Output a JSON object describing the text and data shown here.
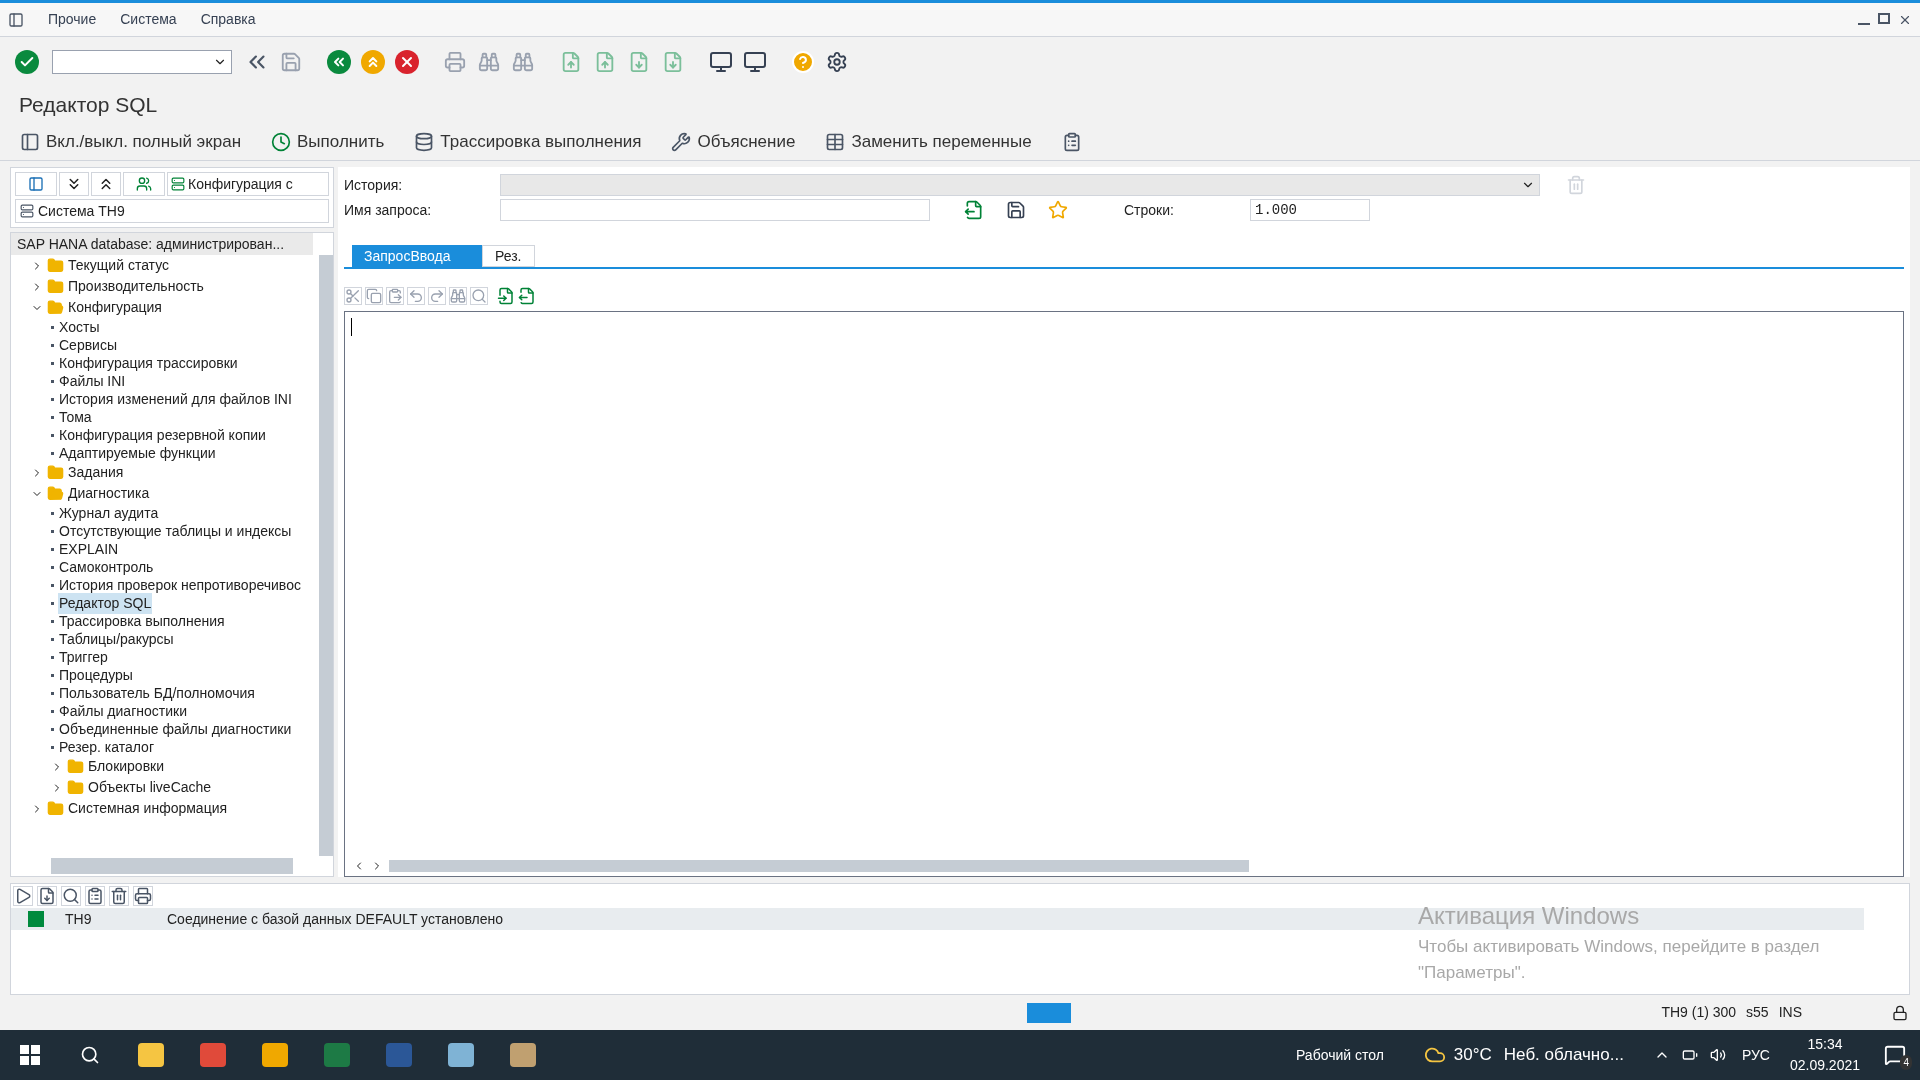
{
  "menu": [
    "Прочие",
    "Система",
    "Справка"
  ],
  "title": "Редактор SQL",
  "app_toolbar": [
    {
      "label": "Вкл./выкл. полный экран",
      "kind": "fullscreen"
    },
    {
      "label": "Выполнить",
      "kind": "execute"
    },
    {
      "label": "Трассировка выполнения",
      "kind": "trace"
    },
    {
      "label": "Объяснение",
      "kind": "explain"
    },
    {
      "label": "Заменить переменные",
      "kind": "replace"
    }
  ],
  "left": {
    "config_dropdown": "Конфигурация с",
    "system": "Система TH9",
    "tree": {
      "header": "SAP HANA database: администрирован...",
      "items": [
        {
          "label": "Текущий статус",
          "kind": "folder",
          "expanded": false
        },
        {
          "label": "Производительность",
          "kind": "folder",
          "expanded": false
        },
        {
          "label": "Конфигурация",
          "kind": "folder",
          "expanded": true,
          "children": [
            {
              "label": "Хосты",
              "kind": "leaf",
              "selected": false
            },
            {
              "label": "Сервисы",
              "kind": "leaf",
              "selected": false
            },
            {
              "label": "Конфигурация трассировки",
              "kind": "leaf",
              "selected": false
            },
            {
              "label": "Файлы INI",
              "kind": "leaf",
              "selected": false
            },
            {
              "label": "История изменений для файлов INI",
              "kind": "leaf",
              "selected": false
            },
            {
              "label": "Тома",
              "kind": "leaf",
              "selected": false
            },
            {
              "label": "Конфигурация резервной копии",
              "kind": "leaf",
              "selected": false
            },
            {
              "label": "Адаптируемые функции",
              "kind": "leaf",
              "selected": false
            }
          ]
        },
        {
          "label": "Задания",
          "kind": "folder",
          "expanded": false
        },
        {
          "label": "Диагностика",
          "kind": "folder",
          "expanded": true,
          "children": [
            {
              "label": "Журнал аудита",
              "kind": "leaf",
              "selected": false
            },
            {
              "label": "Отсутствующие таблицы и индексы",
              "kind": "leaf",
              "selected": false
            },
            {
              "label": "EXPLAIN",
              "kind": "leaf",
              "selected": false
            },
            {
              "label": "Самоконтроль",
              "kind": "leaf",
              "selected": false
            },
            {
              "label": "История проверок непротиворечивос",
              "kind": "leaf",
              "selected": false
            },
            {
              "label": "Редактор SQL",
              "kind": "leaf",
              "selected": true
            },
            {
              "label": "Трассировка выполнения",
              "kind": "leaf",
              "selected": false
            },
            {
              "label": "Таблицы/ракурсы",
              "kind": "leaf",
              "selected": false
            },
            {
              "label": "Триггер",
              "kind": "leaf",
              "selected": false
            },
            {
              "label": "Процедуры",
              "kind": "leaf",
              "selected": false
            },
            {
              "label": "Пользователь БД/полномочия",
              "kind": "leaf",
              "selected": false
            },
            {
              "label": "Файлы диагностики",
              "kind": "leaf",
              "selected": false
            },
            {
              "label": "Объединенные файлы диагностики",
              "kind": "leaf",
              "selected": false
            },
            {
              "label": "Резер. каталог",
              "kind": "leaf",
              "selected": false
            },
            {
              "label": "Блокировки",
              "kind": "folder",
              "expanded": false
            },
            {
              "label": "Объекты liveCache",
              "kind": "folder",
              "expanded": false
            }
          ]
        },
        {
          "label": "Системная информация",
          "kind": "folder",
          "expanded": false
        }
      ]
    }
  },
  "form": {
    "history_label": "История:",
    "query_name_label": "Имя запроса:",
    "rows_label": "Строки:",
    "rows_value": "1.000"
  },
  "tabs": [
    {
      "label": "ЗапросВвода",
      "selected": true
    },
    {
      "label": "Рез.",
      "selected": false
    }
  ],
  "log": [
    {
      "system": "TH9",
      "message": "Соединение с базой данных DEFAULT установлено",
      "color": "#008a3e"
    }
  ],
  "activation": {
    "title": "Активация Windows",
    "text": "Чтобы активировать Windows, перейдите в раздел \"Параметры\"."
  },
  "status": {
    "session": "TH9 (1) 300",
    "server": "s55",
    "mode": "INS"
  },
  "taskbar": {
    "desktop": "Рабочий стол",
    "temperature": "30°C",
    "weather": "Неб. облачно...",
    "language": "РУС",
    "time": "15:34",
    "date": "02.09.2021",
    "notifications": "4"
  }
}
